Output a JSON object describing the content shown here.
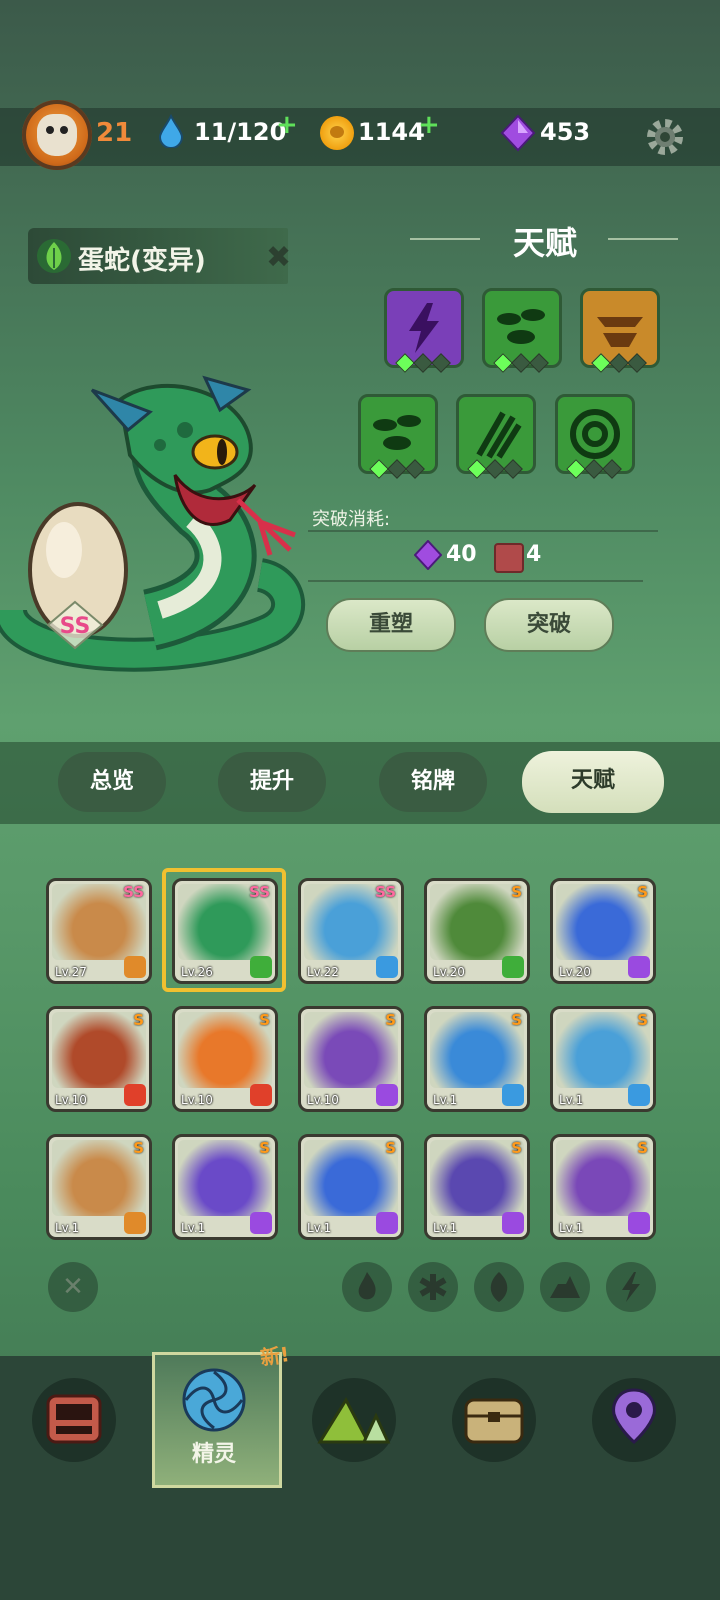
{
  "player": {
    "level": "21"
  },
  "resources": {
    "energy": "11/120",
    "coins": "1144",
    "gems": "453"
  },
  "pet": {
    "name": "蛋蛇(变异)",
    "rank": "SS"
  },
  "talent": {
    "title": "天赋",
    "icons": [
      {
        "name": "lightning-talent-icon",
        "color": "#7a3fb8"
      },
      {
        "name": "leaves-talent-icon",
        "color": "#3a9a3a"
      },
      {
        "name": "gold-bowl-talent-icon",
        "color": "#c98a2a"
      },
      {
        "name": "leaves-talent-icon",
        "color": "#3a9a3a"
      },
      {
        "name": "claw-talent-icon",
        "color": "#3a9a3a"
      },
      {
        "name": "spiral-talent-icon",
        "color": "#3a9a3a"
      }
    ],
    "cost_label": "突破消耗:",
    "cost_gems": "40",
    "cost_books": "4",
    "reroll_label": "重塑",
    "breakthrough_label": "突破"
  },
  "tabs": {
    "overview": "总览",
    "upgrade": "提升",
    "plaque": "铭牌",
    "talent": "天赋"
  },
  "pets": [
    {
      "lv": "Lv.27",
      "rank": "SS",
      "elem": "earth"
    },
    {
      "lv": "Lv.26",
      "rank": "SS",
      "elem": "leaf"
    },
    {
      "lv": "Lv.22",
      "rank": "SS",
      "elem": "ice"
    },
    {
      "lv": "Lv.20",
      "rank": "S",
      "elem": "leaf"
    },
    {
      "lv": "Lv.20",
      "rank": "S",
      "elem": "thunder"
    },
    {
      "lv": "Lv.10",
      "rank": "S",
      "elem": "fire"
    },
    {
      "lv": "Lv.10",
      "rank": "S",
      "elem": "fire"
    },
    {
      "lv": "Lv.10",
      "rank": "S",
      "elem": "thunder"
    },
    {
      "lv": "Lv.1",
      "rank": "S",
      "elem": "ice"
    },
    {
      "lv": "Lv.1",
      "rank": "S",
      "elem": "ice"
    },
    {
      "lv": "Lv.1",
      "rank": "S",
      "elem": "earth"
    },
    {
      "lv": "Lv.1",
      "rank": "S",
      "elem": "thunder"
    },
    {
      "lv": "Lv.1",
      "rank": "S",
      "elem": "thunder"
    },
    {
      "lv": "Lv.1",
      "rank": "S",
      "elem": "thunder"
    },
    {
      "lv": "Lv.1",
      "rank": "S",
      "elem": "thunder"
    }
  ],
  "nav": {
    "spirit_label": "精灵",
    "new_tag": "新!"
  }
}
